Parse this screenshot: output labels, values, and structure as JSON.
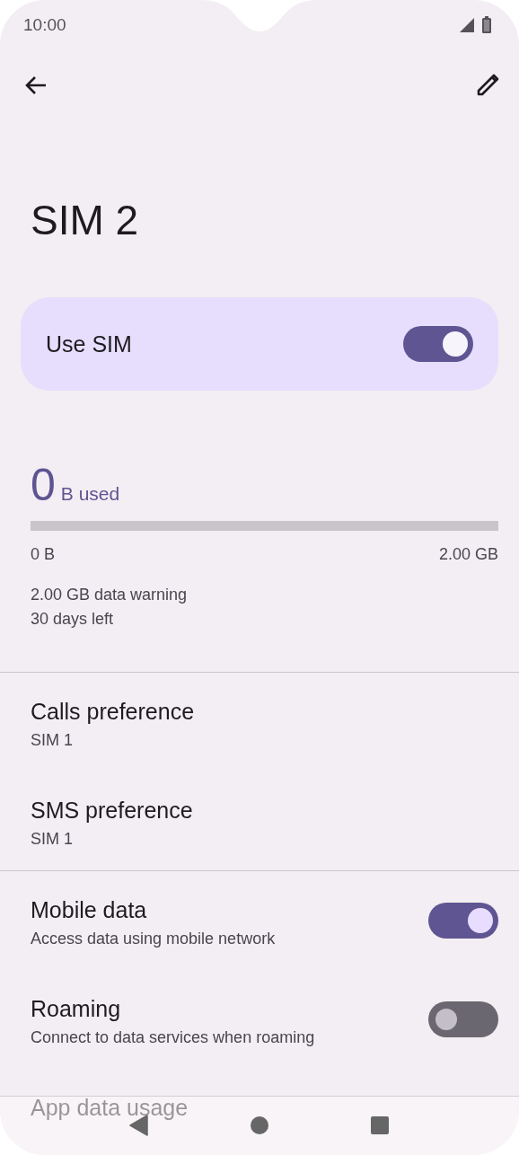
{
  "status_bar": {
    "time": "10:00"
  },
  "title": "SIM 2",
  "use_sim": {
    "label": "Use SIM",
    "on": true
  },
  "usage": {
    "amount": "0",
    "unit": "B used",
    "level": 0,
    "min_label": "0 B",
    "max_label": "2.00 GB",
    "warning": "2.00 GB data warning",
    "days_left": "30 days left"
  },
  "preferences": [
    {
      "title": "Calls preference",
      "value": "SIM 1"
    },
    {
      "title": "SMS preference",
      "value": "SIM 1"
    }
  ],
  "toggles": [
    {
      "title": "Mobile data",
      "subtitle": "Access data using mobile network",
      "on": true
    },
    {
      "title": "Roaming",
      "subtitle": "Connect to data services when roaming",
      "on": false
    }
  ],
  "next_item": {
    "title": "App data usage"
  }
}
